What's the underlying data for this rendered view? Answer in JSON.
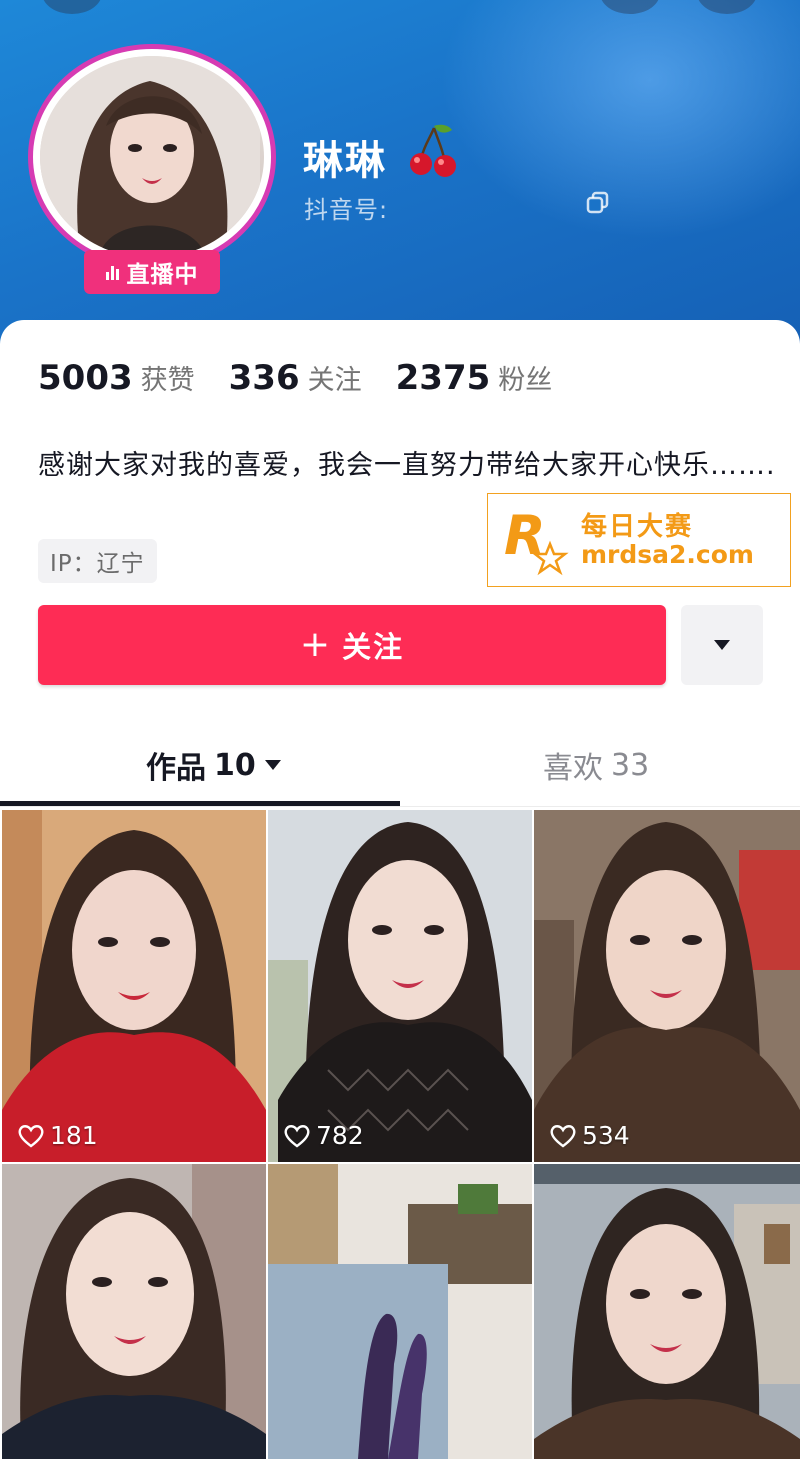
{
  "profile": {
    "name": "琳琳",
    "douyin_id_label": "抖音号:",
    "live_label": "直播中",
    "emoji_icon": "cherry-icon"
  },
  "stats": [
    {
      "value": "5003",
      "label": "获赞"
    },
    {
      "value": "336",
      "label": "关注"
    },
    {
      "value": "2375",
      "label": "粉丝"
    }
  ],
  "bio": {
    "text": "感谢大家对我的喜爱，我会一直努力带给大家开心快乐……."
  },
  "ip": "IP：辽宁",
  "actions": {
    "follow_label": "关注",
    "more_icon": "triangle-down-icon"
  },
  "watermark": {
    "title": "每日大赛",
    "url": "mrdsa2.com",
    "logo_small_text": "每日大赛"
  },
  "tabs": [
    {
      "label": "作品",
      "count": "10",
      "active": true
    },
    {
      "label": "喜欢",
      "count": "33",
      "active": false
    }
  ],
  "videos": [
    {
      "likes": "181"
    },
    {
      "likes": "782"
    },
    {
      "likes": "534"
    },
    {
      "likes": ""
    },
    {
      "likes": ""
    },
    {
      "likes": ""
    }
  ],
  "colors": {
    "header_blue": "#1a73c8",
    "follow_red": "#fe2c55",
    "live_pink": "#f0307c",
    "ring_magenta": "#d63bb3",
    "watermark_orange": "#f39a16"
  }
}
